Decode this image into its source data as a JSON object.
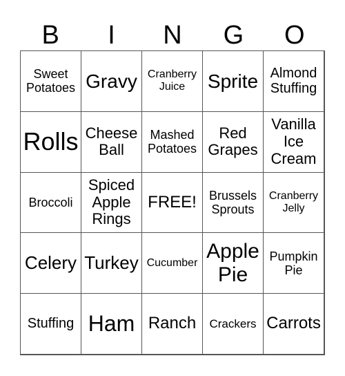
{
  "header": {
    "letters": [
      "B",
      "I",
      "N",
      "G",
      "O"
    ]
  },
  "cells": [
    "Sweet Potatoes",
    "Gravy",
    "Cranberry Juice",
    "Sprite",
    "Almond Stuffing",
    "Rolls",
    "Cheese Ball",
    "Mashed Potatoes",
    "Red Grapes",
    "Vanilla Ice Cream",
    "Broccoli",
    "Spiced Apple Rings",
    "FREE!",
    "Brussels Sprouts",
    "Cranberry Jelly",
    "Celery",
    "Turkey",
    "Cucumber",
    "Apple Pie",
    "Pumpkin Pie",
    "Stuffing",
    "Ham",
    "Ranch",
    "Crackers",
    "Carrots"
  ]
}
